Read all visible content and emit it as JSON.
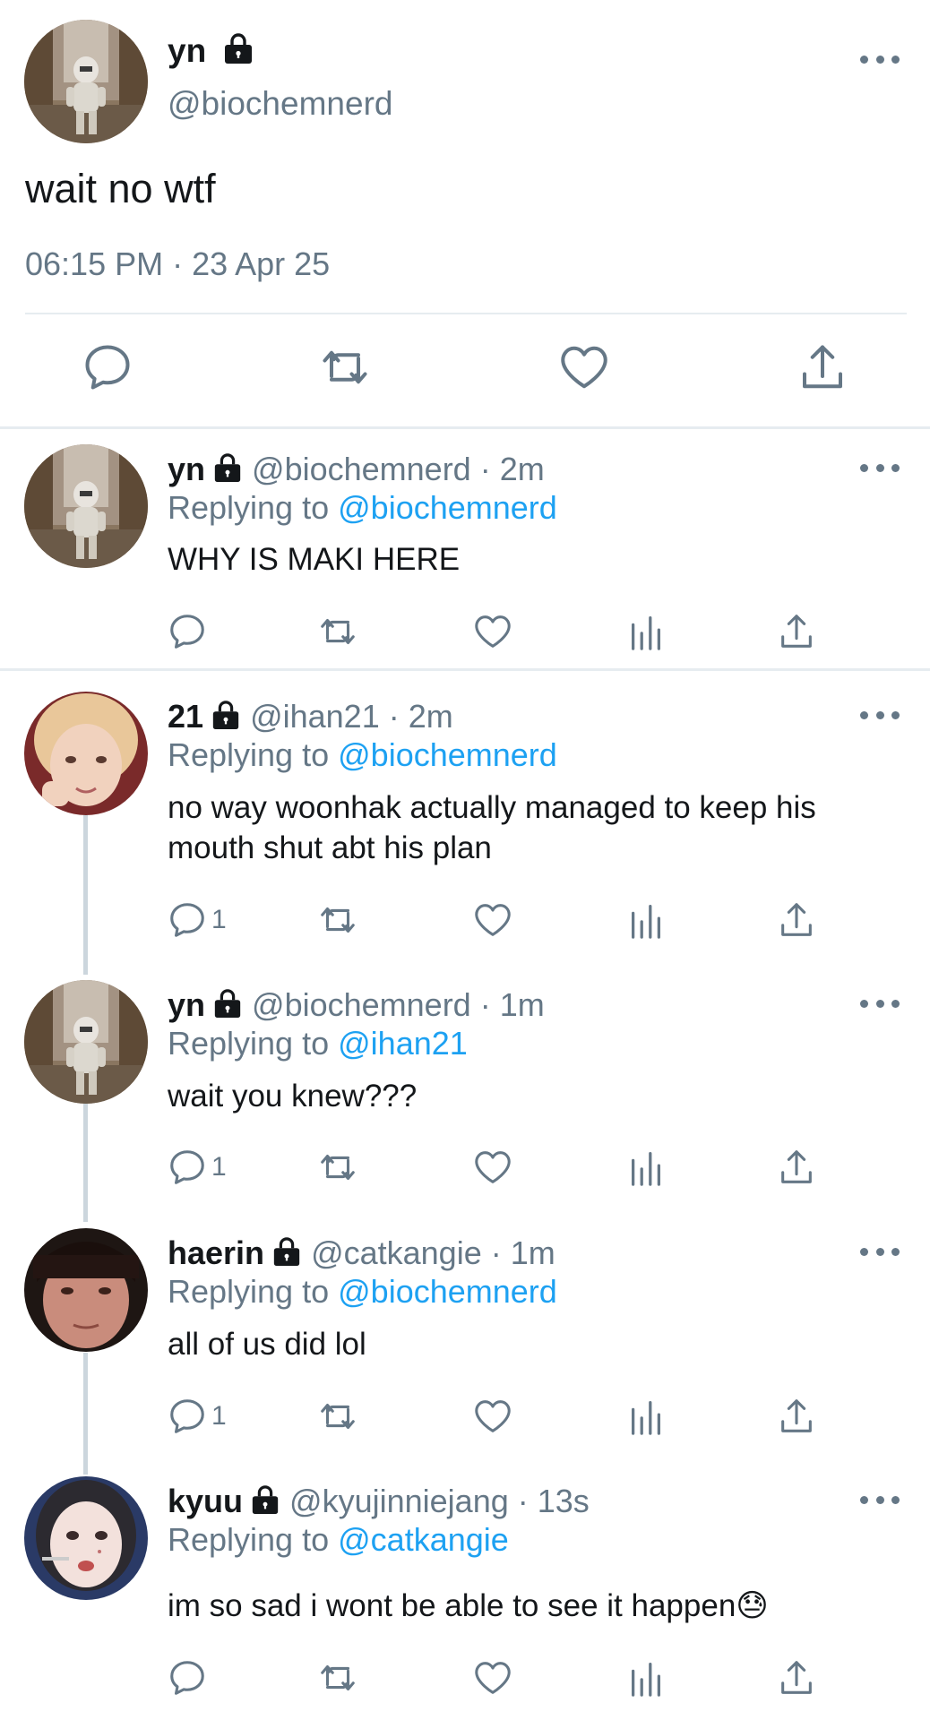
{
  "main_tweet": {
    "name": "yn",
    "handle": "@biochemnerd",
    "text": "wait no wtf",
    "timestamp": "06:15 PM · 23 Apr 25",
    "icons": [
      "reply-icon",
      "retweet-icon",
      "like-icon",
      "share-icon"
    ]
  },
  "replies": [
    {
      "name": "yn",
      "handle_time": "@biochemnerd · 2m",
      "replying_prefix": "Replying to",
      "replying_to": "@biochemnerd",
      "text": "WHY IS MAKI HERE",
      "reply_count": ""
    },
    {
      "name": "21",
      "handle_time": "@ihan21 · 2m",
      "replying_prefix": "Replying to",
      "replying_to": "@biochemnerd",
      "text": "no way woonhak actually managed to keep his mouth shut abt his plan",
      "reply_count": "1"
    },
    {
      "name": "yn",
      "handle_time": "@biochemnerd · 1m",
      "replying_prefix": "Replying to",
      "replying_to": "@ihan21",
      "text": "wait you knew???",
      "reply_count": "1"
    },
    {
      "name": "haerin",
      "handle_time": "@catkangie · 1m",
      "replying_prefix": "Replying to",
      "replying_to": "@biochemnerd",
      "text": "all of us did lol",
      "reply_count": "1"
    },
    {
      "name": "kyuu",
      "handle_time": "@kyujinniejang · 13s",
      "replying_prefix": "Replying to",
      "replying_to": "@catkangie",
      "text": "im so sad i wont be able to see it happen😓",
      "reply_count": ""
    }
  ],
  "colors": {
    "text": "#14171a",
    "secondary": "#657786",
    "link": "#1da1f2",
    "divider": "#e6ecf0"
  }
}
